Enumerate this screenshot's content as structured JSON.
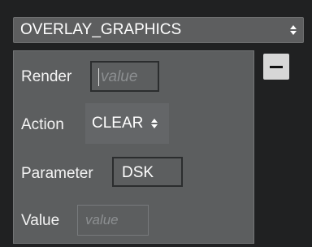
{
  "top_select": {
    "value": "OVERLAY_GRAPHICS",
    "icon": "updown-arrows-icon"
  },
  "remove_button": {
    "icon": "minus-icon"
  },
  "panel": {
    "render": {
      "label": "Render",
      "placeholder": "value"
    },
    "action": {
      "label": "Action",
      "value": "CLEAR",
      "icon": "updown-arrows-icon"
    },
    "parameter": {
      "label": "Parameter",
      "value": "DSK"
    },
    "value_row": {
      "label": "Value",
      "placeholder": "value"
    }
  },
  "colors": {
    "background": "#202122",
    "panel": "#5c5e5f",
    "button": "#d7d7d7"
  }
}
